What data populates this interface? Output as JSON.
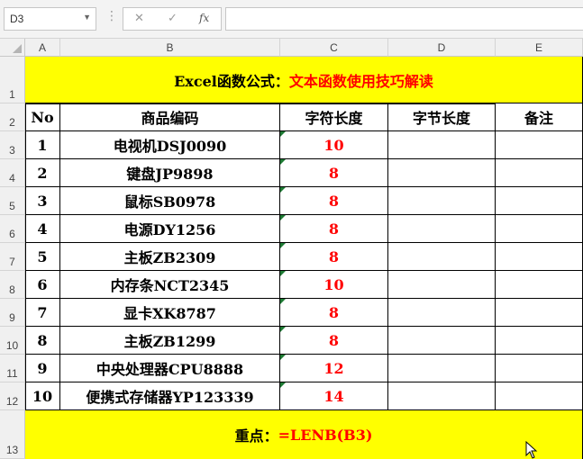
{
  "formula_bar": {
    "name_box": "D3",
    "cancel_icon": "✕",
    "enter_icon": "✓",
    "function_label": "fx",
    "formula": ""
  },
  "columns": [
    "A",
    "B",
    "C",
    "D",
    "E"
  ],
  "row_numbers": [
    "1",
    "2",
    "3",
    "4",
    "5",
    "6",
    "7",
    "8",
    "9",
    "10",
    "11",
    "12",
    "13"
  ],
  "title": {
    "prefix": "Excel函数公式：",
    "suffix": "文本函数使用技巧解读"
  },
  "headers": {
    "no": "No",
    "code": "商品编码",
    "char_len": "字符长度",
    "byte_len": "字节长度",
    "note": "备注"
  },
  "rows": [
    {
      "no": "1",
      "code": "电视机DSJ0090",
      "char_len": "10"
    },
    {
      "no": "2",
      "code": "键盘JP9898",
      "char_len": "8"
    },
    {
      "no": "3",
      "code": "鼠标SB0978",
      "char_len": "8"
    },
    {
      "no": "4",
      "code": "电源DY1256",
      "char_len": "8"
    },
    {
      "no": "5",
      "code": "主板ZB2309",
      "char_len": "8"
    },
    {
      "no": "6",
      "code": "内存条NCT2345",
      "char_len": "10"
    },
    {
      "no": "7",
      "code": "显卡XK8787",
      "char_len": "8"
    },
    {
      "no": "8",
      "code": "主板ZB1299",
      "char_len": "8"
    },
    {
      "no": "9",
      "code": "中央处理器CPU8888",
      "char_len": "12"
    },
    {
      "no": "10",
      "code": "便携式存储器YP123339",
      "char_len": "14"
    }
  ],
  "footer": {
    "prefix": "重点：",
    "formula": "=LENB(B3)"
  },
  "colors": {
    "highlight": "#ffff00",
    "accent_red": "#ff0000",
    "error_marker": "#1e7b34"
  }
}
